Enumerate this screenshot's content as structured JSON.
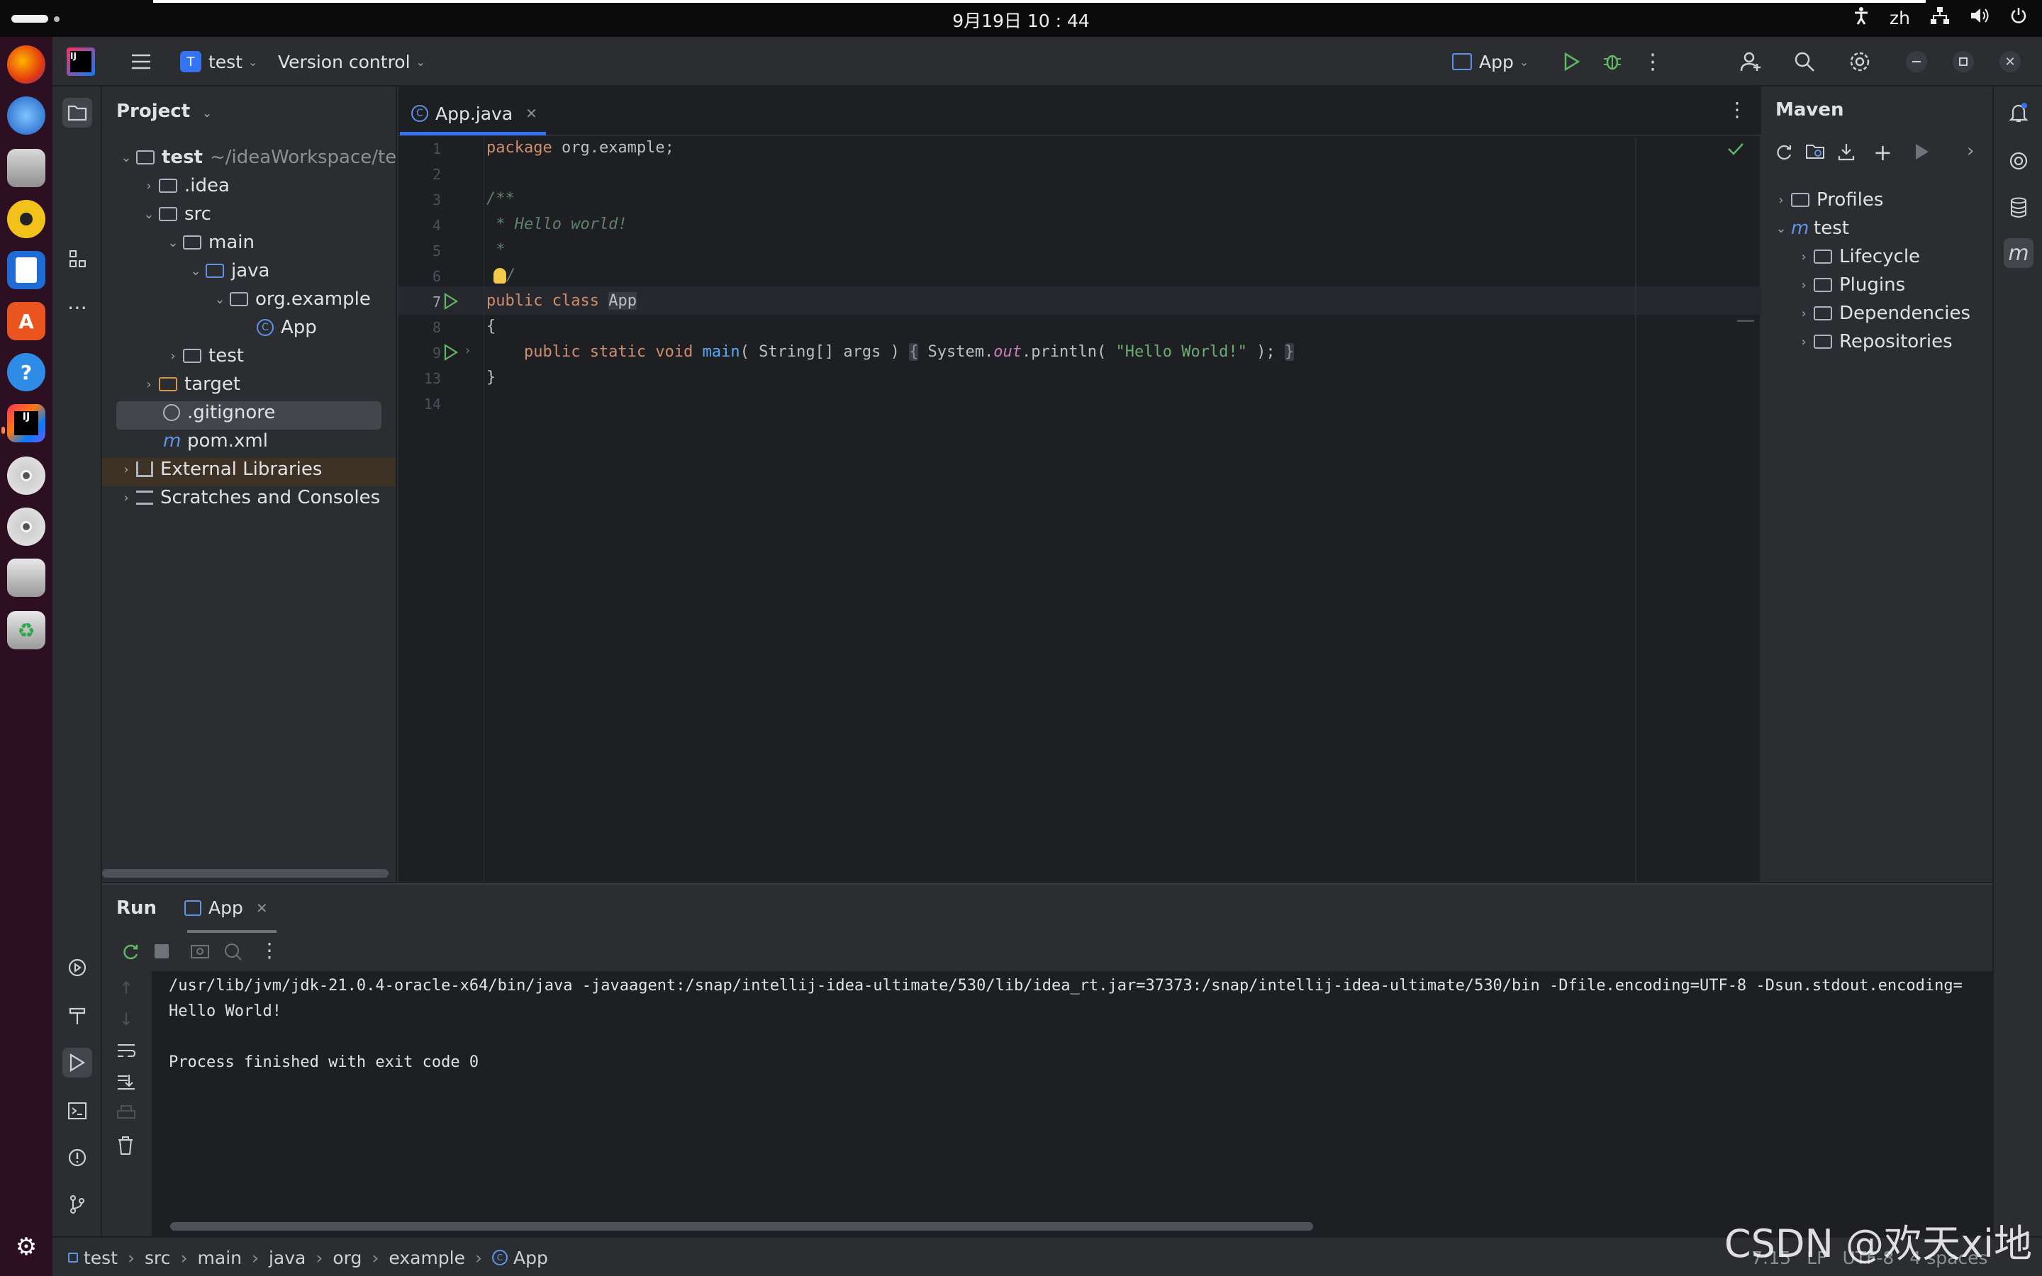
{
  "system": {
    "clock": "9月19日 10 : 44",
    "lang": "zh"
  },
  "titlebar": {
    "project_badge": "T",
    "project_name": "test",
    "version_control": "Version control",
    "run_config": "App"
  },
  "project_panel": {
    "title": "Project",
    "tree": [
      {
        "label": "test",
        "hint": "~/ideaWorkspace/test"
      },
      {
        "label": ".idea"
      },
      {
        "label": "src"
      },
      {
        "label": "main"
      },
      {
        "label": "java"
      },
      {
        "label": "org.example"
      },
      {
        "label": "App"
      },
      {
        "label": "test"
      },
      {
        "label": "target"
      },
      {
        "label": ".gitignore"
      },
      {
        "label": "pom.xml"
      },
      {
        "label": "External Libraries"
      },
      {
        "label": "Scratches and Consoles"
      }
    ]
  },
  "editor": {
    "tab_label": "App.java",
    "line_numbers": [
      "1",
      "2",
      "3",
      "4",
      "5",
      "6",
      "7",
      "8",
      "9",
      "13",
      "14"
    ],
    "code": {
      "l1_kw": "package",
      "l1_rest": " org.example;",
      "l3": "/**",
      "l4": " * Hello world!",
      "l5": " *",
      "l6": "/",
      "l7_kw": "public class",
      "l7_name": "App",
      "l8": "{",
      "l9_kw": "    public static void",
      "l9_fn": "main",
      "l9_args": "( String[] args ) ",
      "l9_fold_open": "{",
      "l9_sys": " System.",
      "l9_out": "out",
      "l9_print": ".println( ",
      "l9_str": "\"Hello World!\"",
      "l9_end": " ); ",
      "l9_fold_close": "}",
      "l13": "}"
    }
  },
  "maven": {
    "title": "Maven",
    "items": [
      {
        "label": "Profiles"
      },
      {
        "label": "test"
      },
      {
        "label": "Lifecycle"
      },
      {
        "label": "Plugins"
      },
      {
        "label": "Dependencies"
      },
      {
        "label": "Repositories"
      }
    ]
  },
  "run": {
    "title": "Run",
    "tab_label": "App",
    "console": [
      "/usr/lib/jvm/jdk-21.0.4-oracle-x64/bin/java -javaagent:/snap/intellij-idea-ultimate/530/lib/idea_rt.jar=37373:/snap/intellij-idea-ultimate/530/bin -Dfile.encoding=UTF-8 -Dsun.stdout.encoding=",
      "Hello World!",
      "",
      "Process finished with exit code 0"
    ]
  },
  "statusbar": {
    "crumbs": [
      "test",
      "src",
      "main",
      "java",
      "org",
      "example",
      "App"
    ],
    "position": "7:15",
    "line_sep": "LF",
    "encoding": "UTF-8",
    "indent": "4 spaces"
  },
  "watermark": "CSDN @欢天xi地",
  "colors": {
    "accent": "#3574f0",
    "run_green": "#5fb865",
    "ide_bg": "#1e1f22",
    "panel_bg": "#2b2d30"
  }
}
